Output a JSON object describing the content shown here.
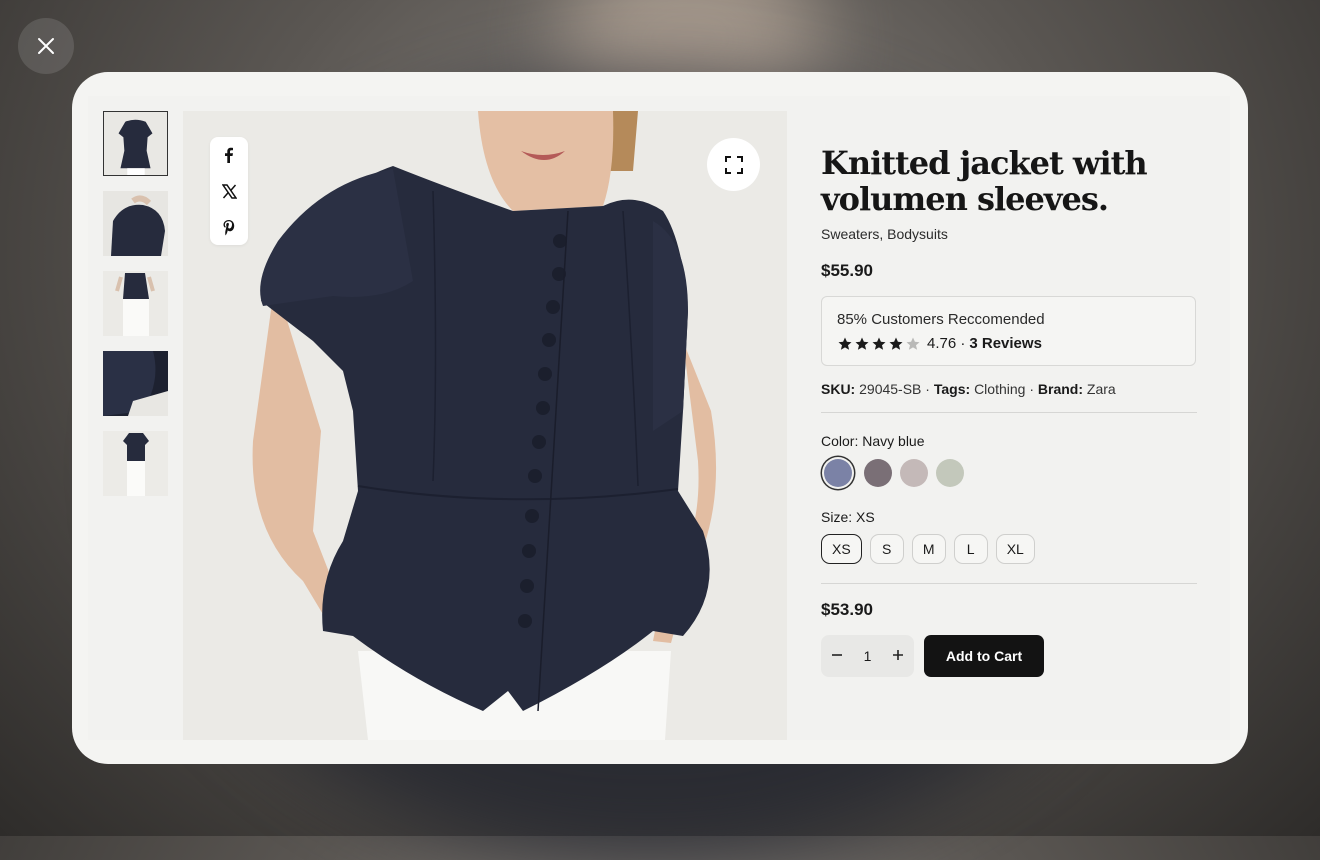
{
  "product": {
    "title": "Knitted jacket with volumen sleeves.",
    "categories": "Sweaters, Bodysuits",
    "price": "$55.90",
    "recommended": "85% Customers Reccomended",
    "rating": 4.76,
    "rating_text": "4.76 ·",
    "stars_filled": 4,
    "stars_total": 5,
    "reviews": "3 Reviews",
    "sku_label": "SKU:",
    "sku": "29045-SB",
    "tags_label": "Tags:",
    "tags": "Clothing",
    "brand_label": "Brand:",
    "brand": "Zara",
    "color_label": "Color:",
    "color_value": "Navy blue",
    "colors": [
      "#7b82a6",
      "#7a6f76",
      "#c4b9b8",
      "#c3c8bb"
    ],
    "size_label": "Size:",
    "size_value": "XS",
    "sizes": [
      "XS",
      "S",
      "M",
      "L",
      "XL"
    ],
    "sale_price": "$53.90",
    "quantity": "1",
    "add_to_cart": "Add to Cart"
  },
  "icons": {
    "close": "close-icon",
    "fullscreen": "expand-icon",
    "share": [
      "facebook-icon",
      "x-icon",
      "pinterest-icon"
    ],
    "qty_minus": "minus-icon",
    "qty_plus": "plus-icon"
  },
  "colors": {
    "garment": "#262b3d",
    "button": "#131313",
    "card": "#f4f4f2"
  }
}
